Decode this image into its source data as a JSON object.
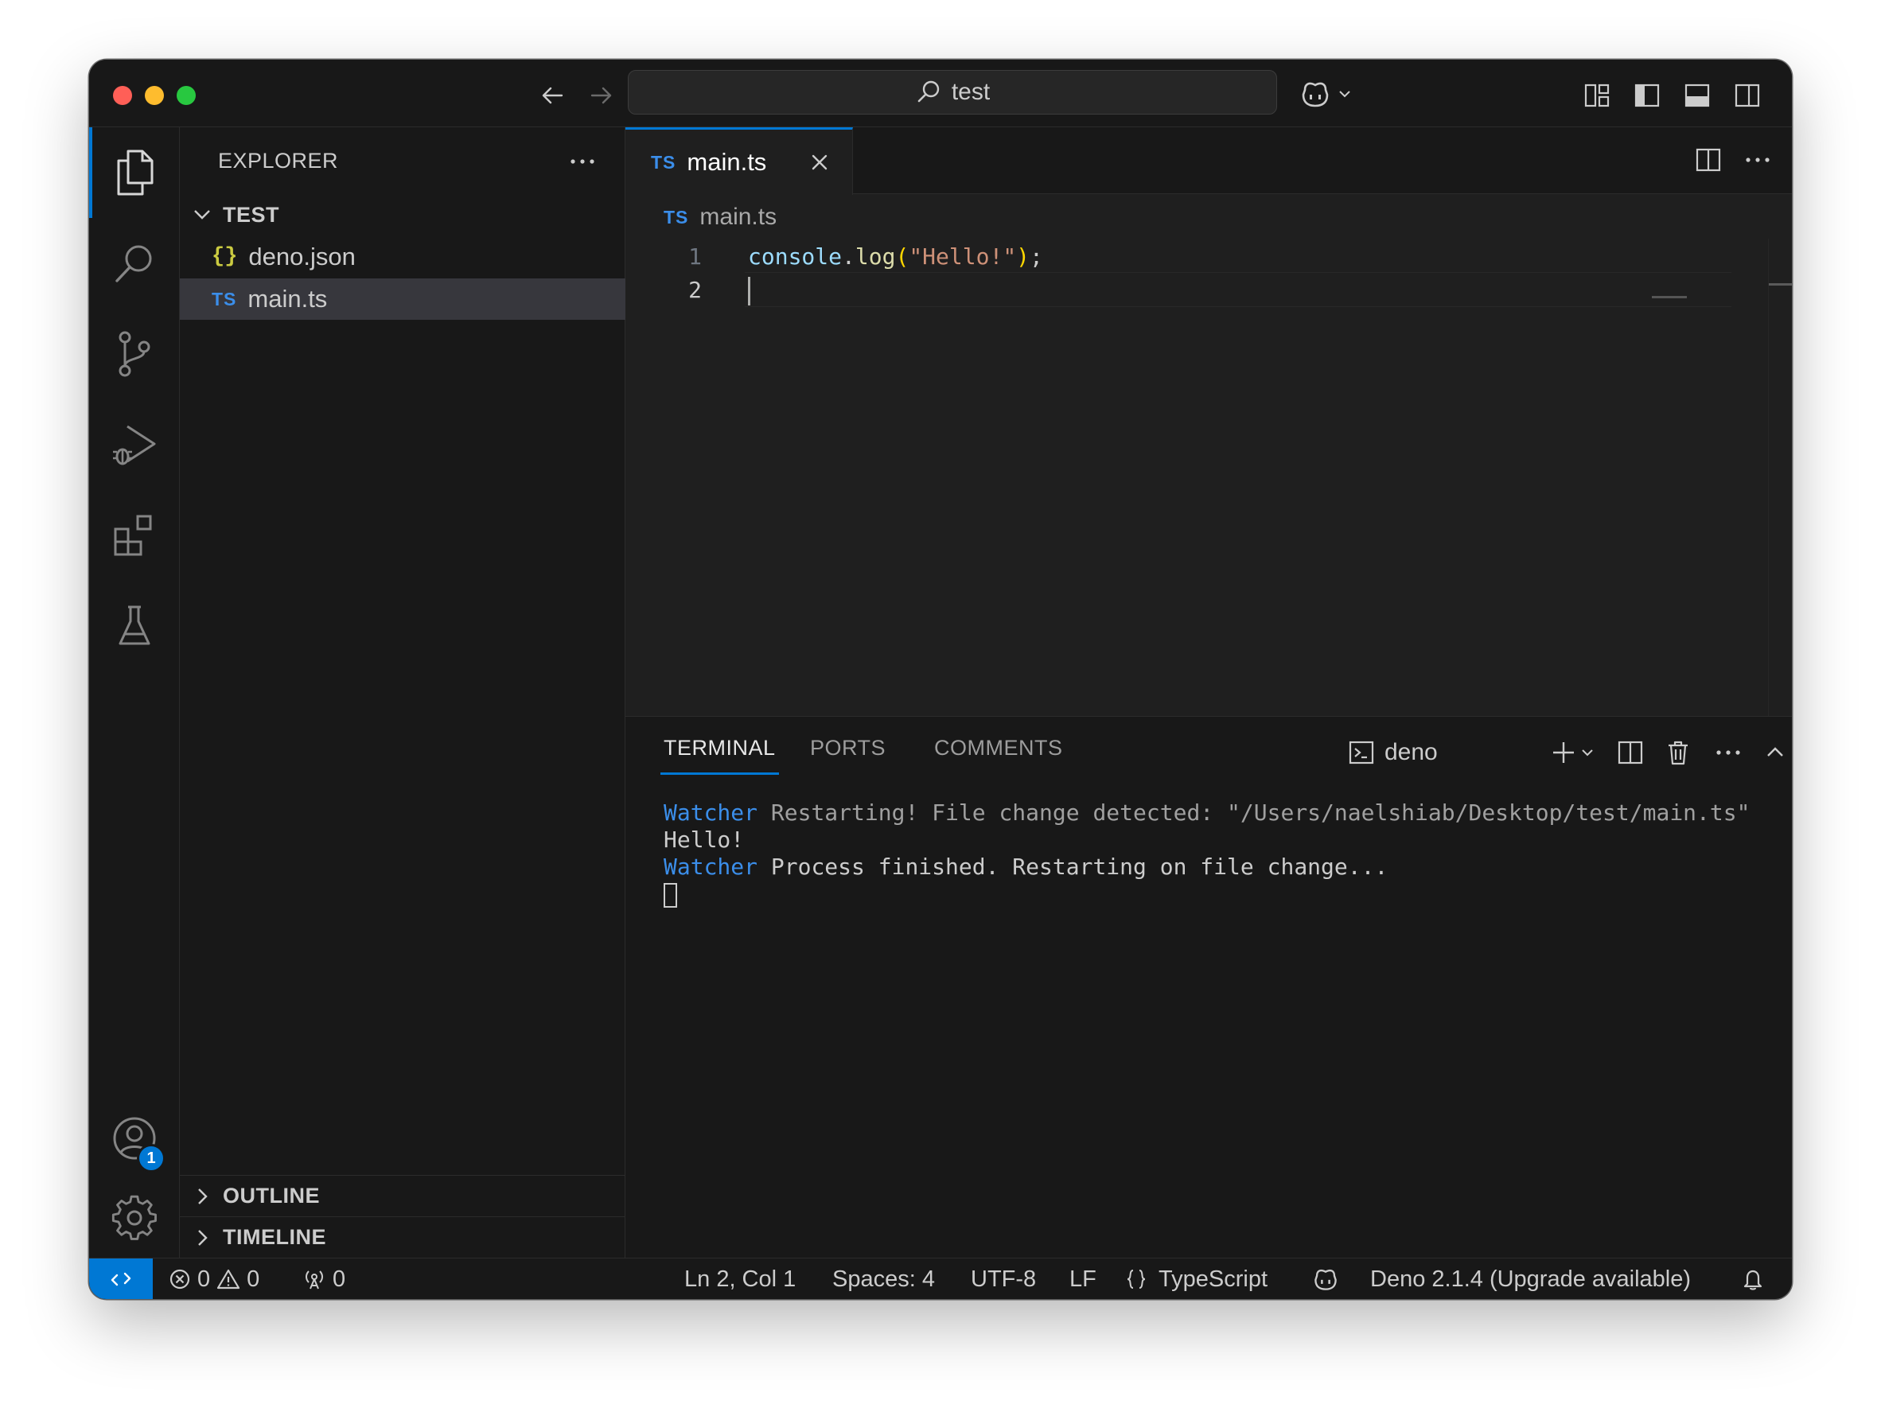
{
  "titlebar": {
    "search_text": "test"
  },
  "activity": {
    "accounts_badge": "1"
  },
  "sidebar": {
    "title": "EXPLORER",
    "folder": "TEST",
    "files": [
      {
        "icon": "{}",
        "name": "deno.json"
      },
      {
        "icon": "TS",
        "name": "main.ts"
      }
    ],
    "sections": [
      "OUTLINE",
      "TIMELINE"
    ]
  },
  "editor": {
    "tab": {
      "icon": "TS",
      "label": "main.ts"
    },
    "breadcrumb": {
      "icon": "TS",
      "label": "main.ts"
    },
    "lines": [
      {
        "number": "1",
        "tokens": {
          "obj": "console",
          "dot": ".",
          "fn": "log",
          "open": "(",
          "str": "\"Hello!\"",
          "close": ")",
          "semi": ";"
        }
      },
      {
        "number": "2"
      }
    ]
  },
  "panel": {
    "tabs": [
      "TERMINAL",
      "PORTS",
      "COMMENTS"
    ],
    "terminal_name": "deno",
    "output": {
      "l1_prefix": "Watcher",
      "l1_text": " Restarting! File change detected: \"/Users/naelshiab/Desktop/test/main.ts\"",
      "l2_text": "Hello!",
      "l3_prefix": "Watcher",
      "l3_text": " Process finished. Restarting on file change..."
    }
  },
  "status": {
    "errors": "0",
    "warnings": "0",
    "ports": "0",
    "position": "Ln 2, Col 1",
    "spaces": "Spaces: 4",
    "encoding": "UTF-8",
    "eol": "LF",
    "language": "TypeScript",
    "deno": "Deno 2.1.4 (Upgrade available)"
  },
  "colors": {
    "accent": "#0078d4",
    "ts": "#3b8eea",
    "json": "#cbcb41"
  }
}
